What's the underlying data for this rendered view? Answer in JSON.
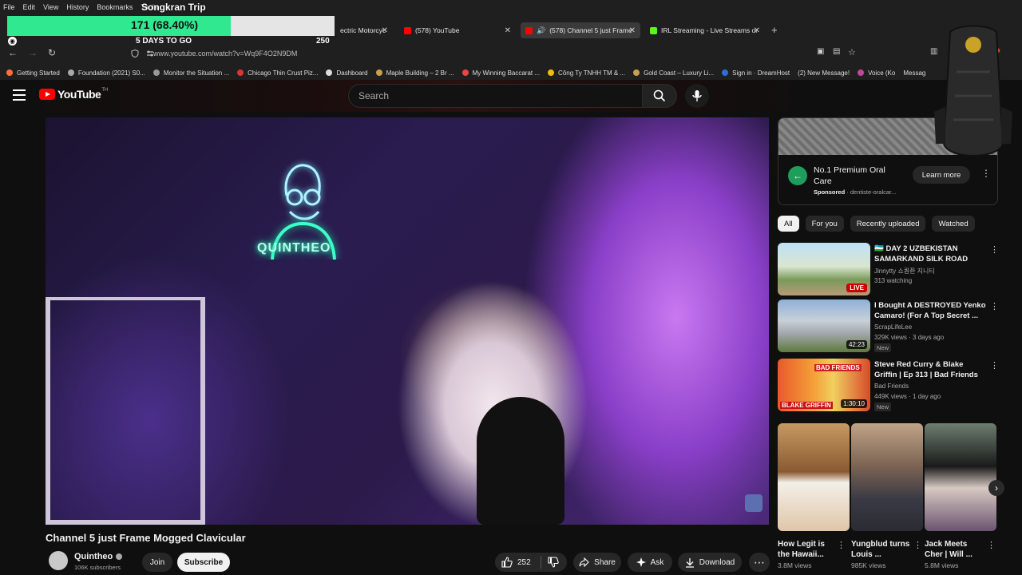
{
  "browser": {
    "menu": [
      "File",
      "Edit",
      "View",
      "History",
      "Bookmarks",
      "Tools"
    ],
    "tabs": [
      {
        "label": "ectric Motorcyc",
        "active": false
      },
      {
        "label": "(578) YouTube",
        "active": false
      },
      {
        "label": "(578) Channel 5 just Frame",
        "active": true
      },
      {
        "label": "IRL Streaming - Live Streams or",
        "active": false
      }
    ],
    "url": "www.youtube.com/watch?v=Wq9F4O2N9DM",
    "bookmarks": [
      "Getting Started",
      "Foundation (2021) S0...",
      "Monitor the Situation ...",
      "Chicago Thin Crust Piz...",
      "Dashboard",
      "Maple Building – 2 Br ...",
      "My Winning Baccarat ...",
      "Công Ty TNHH TM & ...",
      "Gold Coast – Luxury Li...",
      "Sign in · DreamHost",
      "(2) New Message!",
      "Voice (Ko",
      "Messag"
    ]
  },
  "overlay": {
    "title": "Songkran Trip",
    "value": "171 (68.40%)",
    "progress": 0.684,
    "days": "5 DAYS TO GO",
    "target": "250"
  },
  "youtube": {
    "logo": "YouTube",
    "region": "TH",
    "search_placeholder": "Search"
  },
  "video": {
    "title": "Channel 5 just Frame Mogged Clavicular",
    "neon_text": "QUINTHEO",
    "channel": "Quintheo",
    "subscribers": "106K subscribers",
    "join": "Join",
    "subscribe": "Subscribe",
    "likes": "252",
    "share": "Share",
    "ask": "Ask",
    "download": "Download"
  },
  "ad": {
    "title": "No.1 Premium Oral Care",
    "sponsored": "Sponsored",
    "domain": "· dentiste-oralcar...",
    "cta": "Learn more"
  },
  "chips": [
    "All",
    "For you",
    "Recently uploaded",
    "Watched"
  ],
  "recommendations": [
    {
      "title": "🇺🇿 DAY 2 UZBEKISTAN SAMARKAND SILK ROAD CITY...",
      "channel": "Jinnytty 쇼퀀좐 지니티",
      "meta": "313 watching",
      "overlay": "LIVE",
      "badge": ""
    },
    {
      "title": "I Bought A DESTROYED Yenko Camaro! (For A Top Secret ...",
      "channel": "ScrapLifeLee",
      "meta": "329K views · 3 days ago",
      "overlay": "42:23",
      "badge": "New"
    },
    {
      "title": "Steve Red Curry & Blake Griffin | Ep 313 | Bad Friends",
      "channel": "Bad Friends",
      "meta": "449K views · 1 day ago",
      "overlay": "1:30:10",
      "badge": "New"
    }
  ],
  "shorts": [
    {
      "title": "How Legit is the Hawaii...",
      "views": "3.8M views"
    },
    {
      "title": "Yungblud turns Louis ...",
      "views": "985K views"
    },
    {
      "title": "Jack Meets Cher | Will ...",
      "views": "5.8M views"
    }
  ],
  "thumb_text": {
    "bad_friends": "BAD FRIENDS",
    "blake_griffin": "BLAKE GRIFFIN"
  },
  "colors": {
    "yt_red": "#ff0000",
    "goal_fill": "#30e890",
    "neon": "#3fffc8",
    "background": "#0f0f0f"
  }
}
